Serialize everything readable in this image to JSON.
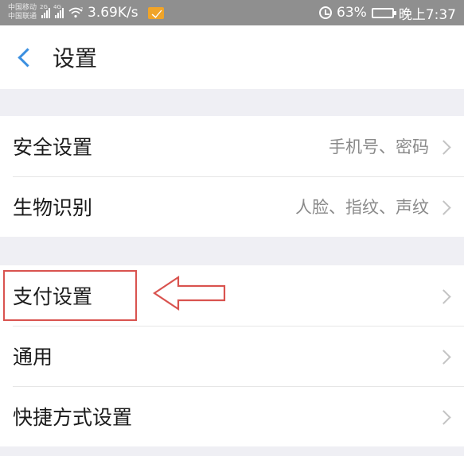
{
  "status_bar": {
    "carrier_1": "中国移动",
    "carrier_2": "中国联通",
    "sim1_tag": "2G",
    "sim2_tag": "4G",
    "wifi_tag": "2",
    "speed": "3.69K/s",
    "battery_percent": "63%",
    "battery_level": 0.63,
    "time": "晚上7:37"
  },
  "header": {
    "title": "设置"
  },
  "group_1": {
    "items": [
      {
        "label": "安全设置",
        "value": "手机号、密码"
      },
      {
        "label": "生物识别",
        "value": "人脸、指纹、声纹"
      }
    ]
  },
  "group_2": {
    "items": [
      {
        "label": "支付设置"
      },
      {
        "label": "通用"
      },
      {
        "label": "快捷方式设置"
      }
    ]
  },
  "colors": {
    "accent": "#3a8fe0",
    "annotation": "#d9534f"
  }
}
